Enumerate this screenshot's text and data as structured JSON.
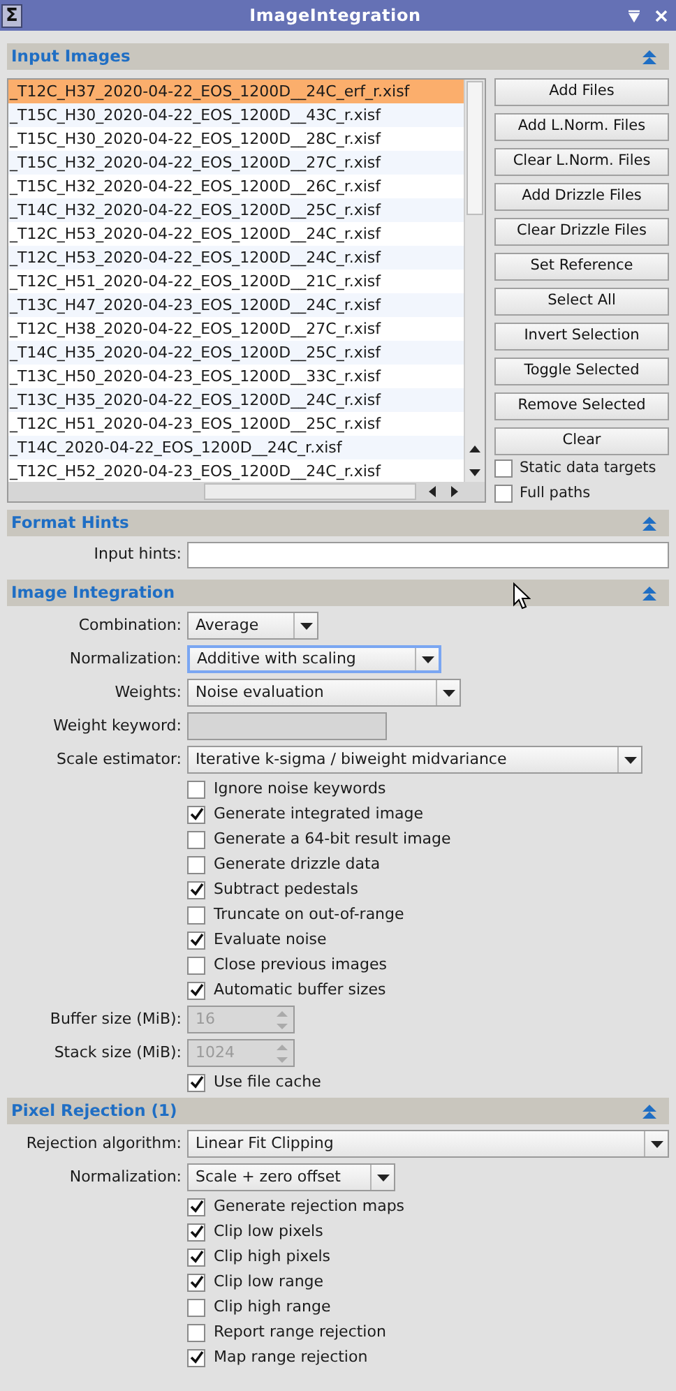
{
  "window": {
    "title": "ImageIntegration",
    "icon": "Σ"
  },
  "input_images": {
    "title": "Input Images",
    "files": [
      {
        "name": "_T12C_H37_2020-04-22_EOS_1200D__24C_erf_r.xisf",
        "selected": true
      },
      {
        "name": "_T15C_H30_2020-04-22_EOS_1200D__43C_r.xisf",
        "selected": false
      },
      {
        "name": "_T15C_H30_2020-04-22_EOS_1200D__28C_r.xisf",
        "selected": false
      },
      {
        "name": "_T15C_H32_2020-04-22_EOS_1200D__27C_r.xisf",
        "selected": false
      },
      {
        "name": "_T15C_H32_2020-04-22_EOS_1200D__26C_r.xisf",
        "selected": false
      },
      {
        "name": "_T14C_H32_2020-04-22_EOS_1200D__25C_r.xisf",
        "selected": false
      },
      {
        "name": "_T12C_H53_2020-04-22_EOS_1200D__24C_r.xisf",
        "selected": false
      },
      {
        "name": "_T12C_H53_2020-04-22_EOS_1200D__24C_r.xisf",
        "selected": false
      },
      {
        "name": "_T12C_H51_2020-04-22_EOS_1200D__21C_r.xisf",
        "selected": false
      },
      {
        "name": "_T13C_H47_2020-04-23_EOS_1200D__24C_r.xisf",
        "selected": false
      },
      {
        "name": "_T12C_H38_2020-04-22_EOS_1200D__27C_r.xisf",
        "selected": false
      },
      {
        "name": "_T14C_H35_2020-04-22_EOS_1200D__25C_r.xisf",
        "selected": false
      },
      {
        "name": "_T13C_H50_2020-04-23_EOS_1200D__33C_r.xisf",
        "selected": false
      },
      {
        "name": "_T13C_H35_2020-04-22_EOS_1200D__24C_r.xisf",
        "selected": false
      },
      {
        "name": "_T12C_H51_2020-04-23_EOS_1200D__25C_r.xisf",
        "selected": false
      },
      {
        "name": "_T14C_2020-04-22_EOS_1200D__24C_r.xisf",
        "selected": false
      },
      {
        "name": "_T12C_H52_2020-04-23_EOS_1200D__24C_r.xisf",
        "selected": false
      }
    ],
    "buttons": [
      "Add Files",
      "Add L.Norm. Files",
      "Clear L.Norm. Files",
      "Add Drizzle Files",
      "Clear Drizzle Files",
      "Set Reference",
      "Select All",
      "Invert Selection",
      "Toggle Selected",
      "Remove Selected",
      "Clear"
    ],
    "options": [
      {
        "label": "Static data targets",
        "checked": false
      },
      {
        "label": "Full paths",
        "checked": false
      }
    ]
  },
  "format_hints": {
    "title": "Format Hints",
    "input_hints": {
      "label": "Input hints:"
    }
  },
  "image_integration": {
    "title": "Image Integration",
    "controls": [
      {
        "kind": "combo",
        "label": "Combination:",
        "value": "Average",
        "focused": false
      },
      {
        "kind": "combo",
        "label": "Normalization:",
        "value": "Additive with scaling",
        "focused": true
      },
      {
        "kind": "combo",
        "label": "Weights:",
        "value": "Noise evaluation",
        "focused": false
      },
      {
        "kind": "field",
        "label": "Weight keyword:",
        "disabled": true
      },
      {
        "kind": "combo",
        "label": "Scale estimator:",
        "value": "Iterative k-sigma / biweight midvariance",
        "focused": false
      },
      {
        "kind": "checkbox",
        "label": "Ignore noise keywords",
        "checked": false
      },
      {
        "kind": "checkbox",
        "label": "Generate integrated image",
        "checked": true
      },
      {
        "kind": "checkbox",
        "label": "Generate a 64-bit result image",
        "checked": false
      },
      {
        "kind": "checkbox",
        "label": "Generate drizzle data",
        "checked": false
      },
      {
        "kind": "checkbox",
        "label": "Subtract pedestals",
        "checked": true
      },
      {
        "kind": "checkbox",
        "label": "Truncate on out-of-range",
        "checked": false
      },
      {
        "kind": "checkbox",
        "label": "Evaluate noise",
        "checked": true
      },
      {
        "kind": "checkbox",
        "label": "Close previous images",
        "checked": false
      },
      {
        "kind": "checkbox",
        "label": "Automatic buffer sizes",
        "checked": true
      },
      {
        "kind": "spin",
        "label": "Buffer size (MiB):",
        "value": "16",
        "disabled": true
      },
      {
        "kind": "spin",
        "label": "Stack size (MiB):",
        "value": "1024",
        "disabled": true
      },
      {
        "kind": "checkbox",
        "label": "Use file cache",
        "checked": true
      }
    ]
  },
  "pixel_rejection": {
    "title": "Pixel Rejection (1)",
    "controls": [
      {
        "kind": "combo",
        "label": "Rejection algorithm:",
        "value": "Linear Fit Clipping",
        "focused": false
      },
      {
        "kind": "combo",
        "label": "Normalization:",
        "value": "Scale + zero offset",
        "focused": false
      },
      {
        "kind": "checkbox",
        "label": "Generate rejection maps",
        "checked": true
      },
      {
        "kind": "checkbox",
        "label": "Clip low pixels",
        "checked": true
      },
      {
        "kind": "checkbox",
        "label": "Clip high pixels",
        "checked": true
      },
      {
        "kind": "checkbox",
        "label": "Clip low range",
        "checked": true
      },
      {
        "kind": "checkbox",
        "label": "Clip high range",
        "checked": false
      },
      {
        "kind": "checkbox",
        "label": "Report range rejection",
        "checked": false
      },
      {
        "kind": "checkbox",
        "label": "Map range rejection",
        "checked": true
      }
    ]
  }
}
